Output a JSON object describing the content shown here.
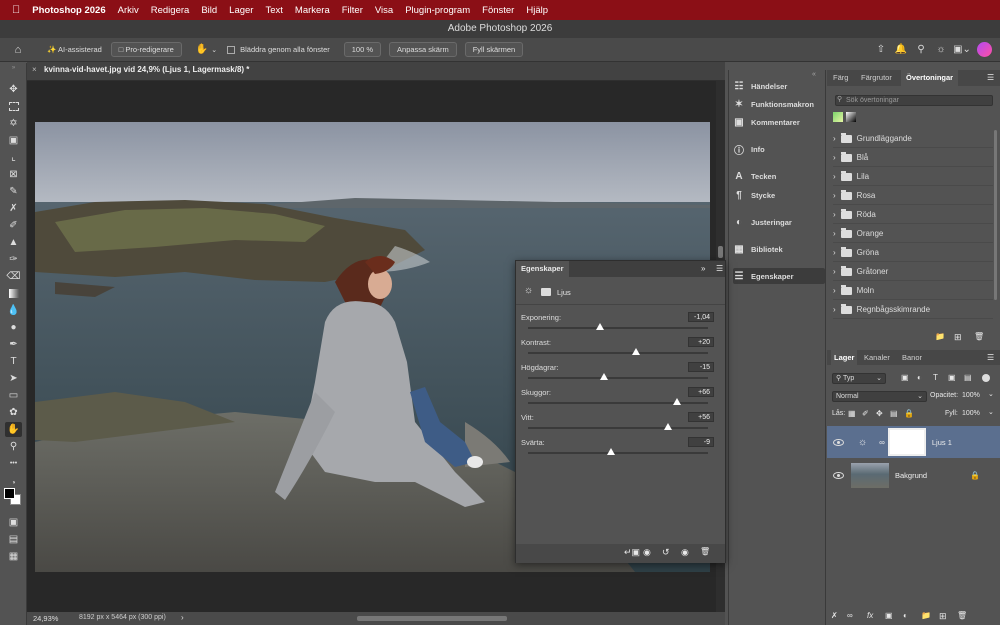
{
  "menubar": {
    "apple_icon": "apple-icon",
    "app_name": "Photoshop 2026",
    "items": [
      "Arkiv",
      "Redigera",
      "Bild",
      "Lager",
      "Text",
      "Markera",
      "Filter",
      "Visa",
      "Plugin-program",
      "Fönster",
      "Hjälp"
    ]
  },
  "window": {
    "title": "Adobe Photoshop 2026"
  },
  "options": {
    "ai_label": "AI-assisterad",
    "pro_label": "Pro-redigerare",
    "scroll_all_label": "Bläddra genom alla fönster",
    "zoom_value": "100 %",
    "fit_screen": "Anpassa skärm",
    "fill_screen": "Fyll skärmen"
  },
  "document": {
    "tab_title": "kvinna-vid-havet.jpg vid 24,9% (Ljus 1, Lagermask/8) *",
    "zoom_status": "24,93%",
    "dimensions": "8192 px x 5464 px (300 ppi)"
  },
  "midpanel": {
    "items": [
      "Händelser",
      "Funktionsmakron",
      "Kommentarer",
      "Info",
      "Tecken",
      "Stycke",
      "Justeringar",
      "Bibliotek",
      "Egenskaper"
    ]
  },
  "right_top": {
    "tabs": [
      "Färg",
      "Färgrutor",
      "Övertoningar"
    ],
    "search_placeholder": "Sök övertoningar",
    "gradient_groups": [
      "Grundläggande",
      "Blå",
      "Lila",
      "Rosa",
      "Röda",
      "Orange",
      "Gröna",
      "Gråtoner",
      "Moln",
      "Regnbågsskimrande"
    ]
  },
  "layers_panel": {
    "tabs": [
      "Lager",
      "Kanaler",
      "Banor"
    ],
    "filter_label": "Typ",
    "blend_mode": "Normal",
    "opacity_label": "Opacitet:",
    "opacity_value": "100%",
    "lock_label": "Lås:",
    "fill_label": "Fyll:",
    "fill_value": "100%",
    "layers": [
      {
        "name": "Ljus 1",
        "selected": true
      },
      {
        "name": "Bakgrund",
        "selected": false
      }
    ]
  },
  "properties": {
    "title": "Egenskaper",
    "subtitle": "Ljus",
    "sliders": [
      {
        "label": "Exponering:",
        "value": "-1,04",
        "pos": 0.4
      },
      {
        "label": "Kontrast:",
        "value": "+20",
        "pos": 0.6
      },
      {
        "label": "Högdagrar:",
        "value": "-15",
        "pos": 0.42
      },
      {
        "label": "Skuggor:",
        "value": "+66",
        "pos": 0.83
      },
      {
        "label": "Vitt:",
        "value": "+56",
        "pos": 0.78
      },
      {
        "label": "Svärta:",
        "value": "-9",
        "pos": 0.46
      }
    ]
  }
}
